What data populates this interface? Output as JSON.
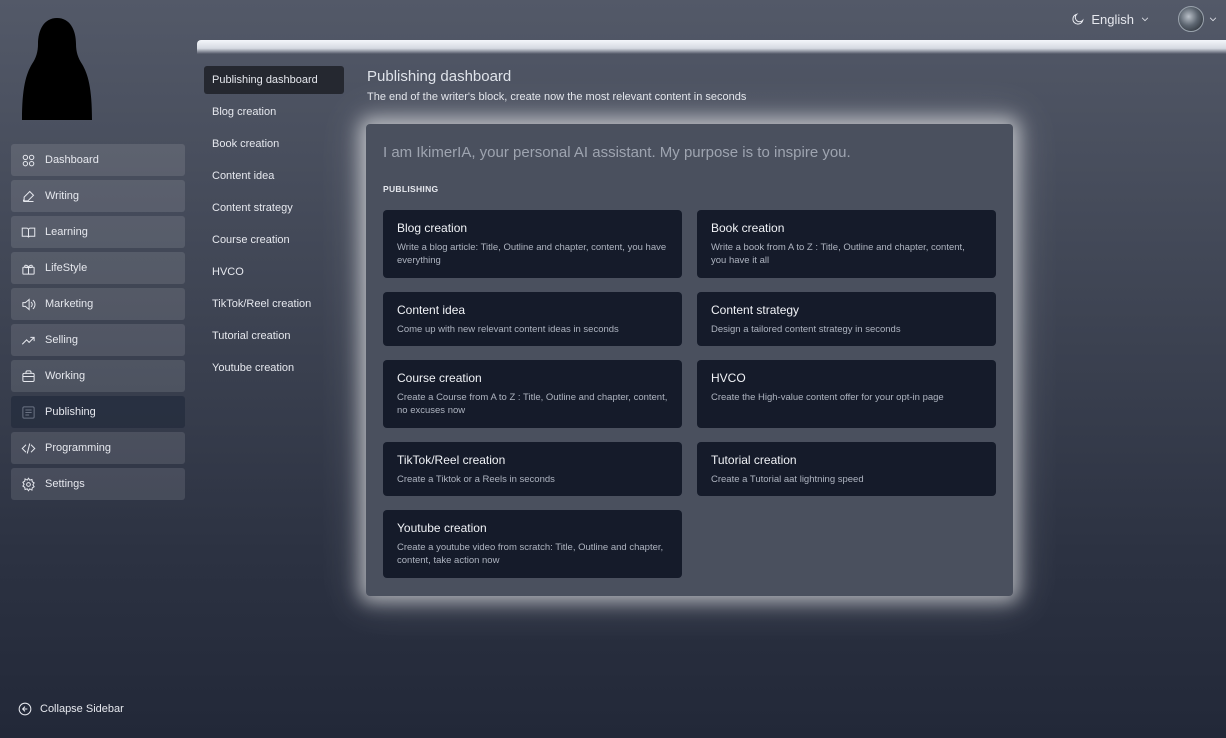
{
  "topbar": {
    "language": "English",
    "theme_icon": "moon-icon",
    "avatar": "user-avatar"
  },
  "sidebar": {
    "items": [
      {
        "label": "Dashboard",
        "icon": "grid-icon"
      },
      {
        "label": "Writing",
        "icon": "edit-icon"
      },
      {
        "label": "Learning",
        "icon": "book-icon"
      },
      {
        "label": "LifeStyle",
        "icon": "sparkle-icon"
      },
      {
        "label": "Marketing",
        "icon": "megaphone-icon"
      },
      {
        "label": "Selling",
        "icon": "trend-icon"
      },
      {
        "label": "Working",
        "icon": "briefcase-icon"
      },
      {
        "label": "Publishing",
        "icon": "newspaper-icon",
        "active": true
      },
      {
        "label": "Programming",
        "icon": "code-icon"
      },
      {
        "label": "Settings",
        "icon": "gear-icon"
      }
    ],
    "collapse_label": "Collapse Sidebar"
  },
  "submenu": {
    "items": [
      {
        "label": "Publishing dashboard",
        "active": true
      },
      {
        "label": "Blog creation"
      },
      {
        "label": "Book creation"
      },
      {
        "label": "Content idea"
      },
      {
        "label": "Content strategy"
      },
      {
        "label": "Course creation"
      },
      {
        "label": "HVCO"
      },
      {
        "label": "TikTok/Reel creation"
      },
      {
        "label": "Tutorial creation"
      },
      {
        "label": "Youtube creation"
      }
    ]
  },
  "main": {
    "title": "Publishing dashboard",
    "subtitle": "The end of the writer's block, create now the most relevant content in seconds",
    "intro": "I am IkimerIA, your personal AI assistant. My purpose is to inspire you.",
    "section_label": "PUBLISHING",
    "cards": [
      {
        "title": "Blog creation",
        "desc": "Write a blog article: Title, Outline and chapter, content, you have everything"
      },
      {
        "title": "Book creation",
        "desc": "Write a book from A to Z : Title, Outline and chapter, content, you have it all"
      },
      {
        "title": "Content idea",
        "desc": "Come up with new relevant content ideas in seconds"
      },
      {
        "title": "Content strategy",
        "desc": "Design a tailored content strategy in seconds"
      },
      {
        "title": "Course creation",
        "desc": "Create a Course from A to Z : Title, Outline and chapter, content, no excuses now"
      },
      {
        "title": "HVCO",
        "desc": "Create the High-value content offer for your opt-in page"
      },
      {
        "title": "TikTok/Reel creation",
        "desc": "Create a Tiktok or a Reels in seconds"
      },
      {
        "title": "Tutorial creation",
        "desc": "Create a Tutorial aat lightning speed"
      },
      {
        "title": "Youtube creation",
        "desc": "Create a youtube video from scratch: Title, Outline and chapter, content, take action now"
      }
    ]
  }
}
